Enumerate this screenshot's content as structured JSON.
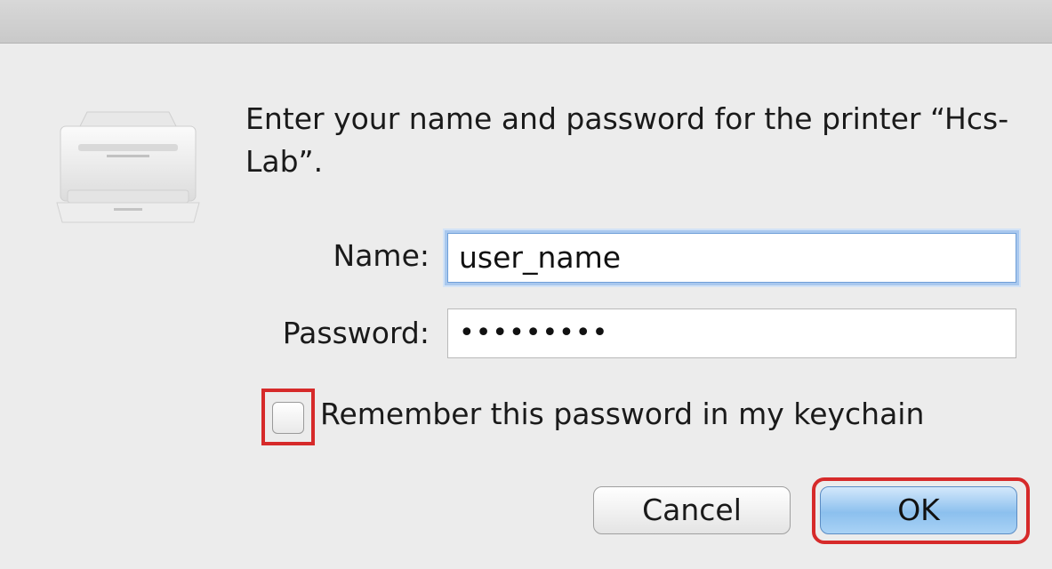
{
  "dialog": {
    "message": "Enter your name and password for the printer “Hcs-Lab”.",
    "icon": "printer-icon"
  },
  "form": {
    "name_label": "Name:",
    "name_value": "user_name",
    "password_label": "Password:",
    "password_value": "•••••••••",
    "remember_label": "Remember this password in my keychain",
    "remember_checked": false
  },
  "buttons": {
    "cancel": "Cancel",
    "ok": "OK"
  },
  "colors": {
    "highlight": "#d62a2a",
    "default_button": "#8cc0ee",
    "focus_ring": "#a9c8ee"
  }
}
